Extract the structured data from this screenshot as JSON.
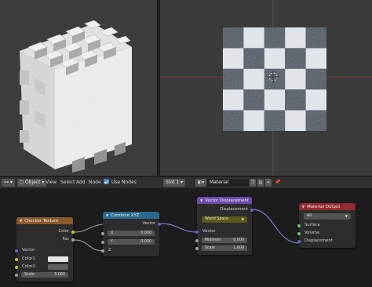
{
  "colors": {
    "header_checker": "#8a5a2c",
    "header_combine": "#2b6a8c",
    "header_vecdisp": "#6a4aaa",
    "header_output": "#932a32",
    "socket_color": "#c7c729",
    "socket_float": "#a1a1a1",
    "socket_vector": "#6363c7",
    "socket_shader": "#63c763",
    "world_space_dropdown": "#5a5a1c"
  },
  "header": {
    "editor_type_icon": "node-tree-icon",
    "object_label": "Object",
    "menus": [
      "View",
      "Select",
      "Add",
      "Node"
    ],
    "use_nodes_label": "Use Nodes",
    "slot_label": "Slot 1",
    "material_name": "Material",
    "copy_icon": "copy-icon",
    "browse_icon": "browse-icon",
    "close_icon": "close-icon",
    "pin_icon": "pin-icon"
  },
  "nodes": {
    "checker": {
      "title": "Checker Texture",
      "outputs": [
        "Color",
        "Fac"
      ],
      "vector_label": "Vector",
      "color1_label": "Color1",
      "color2_label": "Color2",
      "color1": "#e6e6e6",
      "color2": "#5e5e5e",
      "scale_label": "Scale",
      "scale_value": "5.000"
    },
    "combine": {
      "title": "Combine XYZ",
      "output": "Vector",
      "inputs": [
        {
          "label": "X",
          "value": "0.000"
        },
        {
          "label": "Y",
          "value": "0.000"
        }
      ],
      "z_label": "Z"
    },
    "vecdisp": {
      "title": "Vector Displacement",
      "output": "Displacement",
      "space_option": "World Space",
      "vector_label": "Vector",
      "midlevel_label": "Midlevel",
      "midlevel_value": "0.000",
      "scale_label": "Scale",
      "scale_value": "1.000"
    },
    "output": {
      "title": "Material Output",
      "target": "All",
      "inputs": [
        "Surface",
        "Volume",
        "Displacement"
      ]
    }
  }
}
